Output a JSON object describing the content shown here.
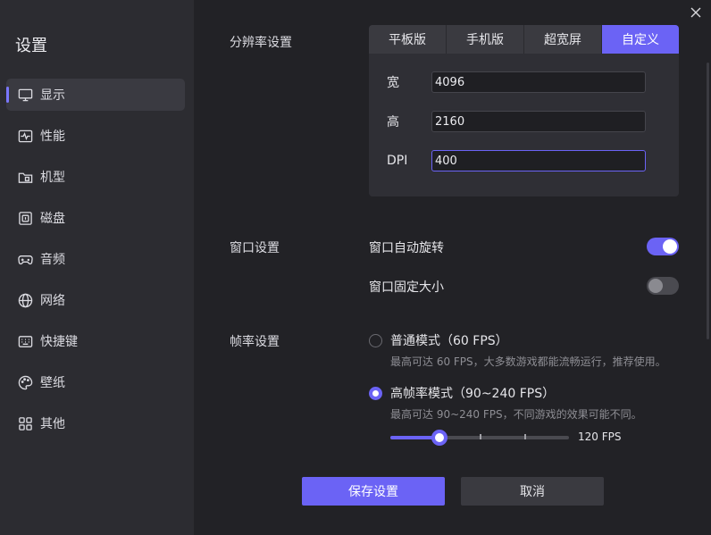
{
  "sidebar": {
    "title": "设置",
    "items": [
      {
        "label": "显示",
        "icon": "monitor-icon",
        "active": true
      },
      {
        "label": "性能",
        "icon": "performance-icon"
      },
      {
        "label": "机型",
        "icon": "device-model-icon"
      },
      {
        "label": "磁盘",
        "icon": "disk-icon"
      },
      {
        "label": "音频",
        "icon": "gamepad-audio-icon"
      },
      {
        "label": "网络",
        "icon": "globe-icon"
      },
      {
        "label": "快捷键",
        "icon": "keyboard-icon"
      },
      {
        "label": "壁纸",
        "icon": "palette-icon"
      },
      {
        "label": "其他",
        "icon": "grid-icon"
      }
    ]
  },
  "resolution": {
    "label": "分辨率设置",
    "tabs": [
      "平板版",
      "手机版",
      "超宽屏",
      "自定义"
    ],
    "active_tab": "自定义",
    "width_label": "宽",
    "width_value": "4096",
    "height_label": "高",
    "height_value": "2160",
    "dpi_label": "DPI",
    "dpi_value": "400"
  },
  "window": {
    "label": "窗口设置",
    "auto_rotate_label": "窗口自动旋转",
    "auto_rotate_on": true,
    "fixed_size_label": "窗口固定大小",
    "fixed_size_on": false
  },
  "framerate": {
    "label": "帧率设置",
    "normal_label": "普通模式（60 FPS）",
    "normal_desc": "最高可达 60 FPS，大多数游戏都能流畅运行，推荐使用。",
    "normal_selected": false,
    "high_label": "高帧率模式（90~240 FPS）",
    "high_desc": "最高可达 90~240 FPS，不同游戏的效果可能不同。",
    "high_selected": true,
    "slider_value": 120,
    "slider_min": 90,
    "slider_max": 240,
    "slider_value_label": "120 FPS"
  },
  "actions": {
    "save_label": "保存设置",
    "cancel_label": "取消"
  },
  "colors": {
    "accent": "#6b63f5",
    "sidebar_bg": "#2c2c31",
    "main_bg": "#222226"
  }
}
